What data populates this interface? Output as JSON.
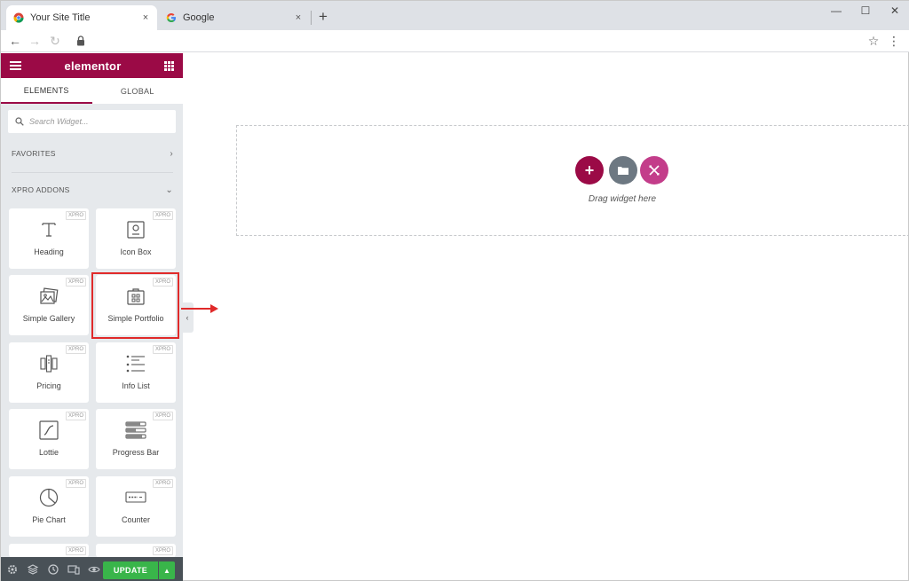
{
  "browser": {
    "tabs": [
      {
        "title": "Your Site Title",
        "active": true,
        "icon": "chrome-favicon-icon"
      },
      {
        "title": "Google",
        "active": false,
        "icon": "google-favicon-icon"
      }
    ],
    "close_glyph": "×",
    "newtab_glyph": "+",
    "window_controls": {
      "minimize": "—",
      "maximize": "☐",
      "close": "✕"
    },
    "nav": {
      "back": "←",
      "forward": "→",
      "reload": "↻"
    },
    "star": "☆",
    "menu": "⋮"
  },
  "panel": {
    "brand": "elementor",
    "tabs": [
      "ELEMENTS",
      "GLOBAL"
    ],
    "search_placeholder": "Search Widget...",
    "sections": {
      "favorites": {
        "label": "FAVORITES",
        "chevron": "›"
      },
      "xpro": {
        "label": "XPRO ADDONS",
        "chevron": "⌄"
      }
    },
    "badge": "XPRO",
    "widgets": [
      {
        "label": "Heading",
        "icon": "heading-icon"
      },
      {
        "label": "Icon Box",
        "icon": "icon-box-icon"
      },
      {
        "label": "Simple Gallery",
        "icon": "gallery-icon"
      },
      {
        "label": "Simple Portfolio",
        "icon": "portfolio-icon"
      },
      {
        "label": "Pricing",
        "icon": "pricing-icon"
      },
      {
        "label": "Info List",
        "icon": "info-list-icon"
      },
      {
        "label": "Lottie",
        "icon": "lottie-icon"
      },
      {
        "label": "Progress Bar",
        "icon": "progress-bar-icon"
      },
      {
        "label": "Pie Chart",
        "icon": "pie-chart-icon"
      },
      {
        "label": "Counter",
        "icon": "counter-icon"
      }
    ],
    "collapse_glyph": "‹",
    "footer": {
      "update_label": "UPDATE",
      "caret": "▲"
    }
  },
  "canvas": {
    "add_glyph": "+",
    "drag_text": "Drag widget here"
  },
  "colors": {
    "elementor_brand": "#9b0a46",
    "update_green": "#39b54a",
    "highlight_red": "#e02a2a",
    "xpro_pink": "#c33d8a"
  }
}
